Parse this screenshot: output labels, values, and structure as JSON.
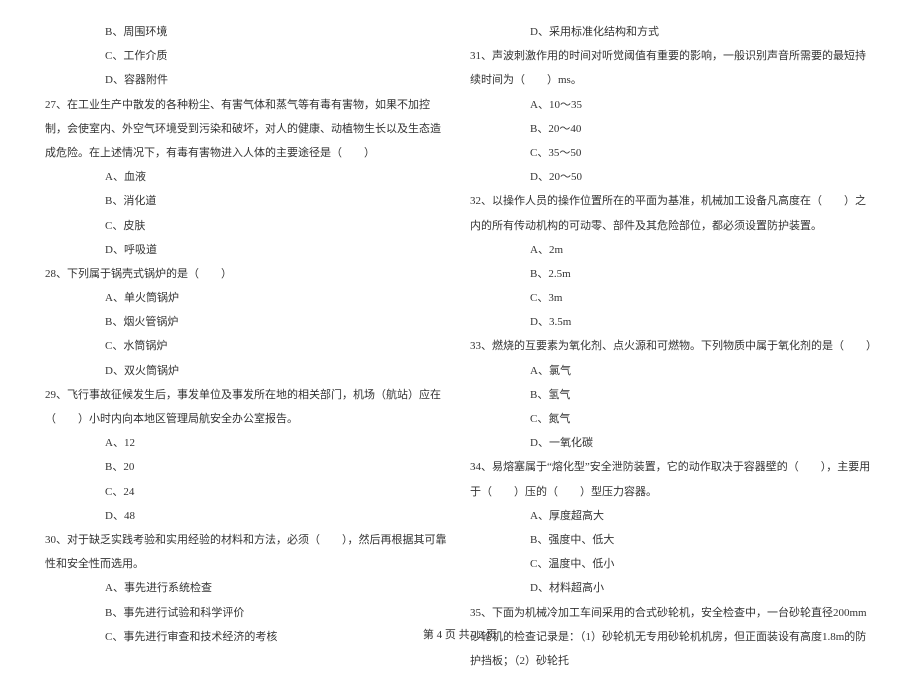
{
  "left": {
    "opt_b_26": "B、周围环境",
    "opt_c_26": "C、工作介质",
    "opt_d_26": "D、容器附件",
    "q27": "27、在工业生产中散发的各种粉尘、有害气体和蒸气等有毒有害物，如果不加控制，会使室内、外空气环境受到污染和破坏，对人的健康、动植物生长以及生态造成危险。在上述情况下，有毒有害物进入人体的主要途径是（　　）",
    "q27_a": "A、血液",
    "q27_b": "B、消化道",
    "q27_c": "C、皮肤",
    "q27_d": "D、呼吸道",
    "q28": "28、下列属于锅壳式锅炉的是（　　）",
    "q28_a": "A、单火筒锅炉",
    "q28_b": "B、烟火管锅炉",
    "q28_c": "C、水筒锅炉",
    "q28_d": "D、双火筒锅炉",
    "q29": "29、飞行事故征候发生后，事发单位及事发所在地的相关部门，机场（航站）应在（　　）小时内向本地区管理局航安全办公室报告。",
    "q29_a": "A、12",
    "q29_b": "B、20",
    "q29_c": "C、24",
    "q29_d": "D、48",
    "q30": "30、对于缺乏实践考验和实用经验的材料和方法，必须（　　），然后再根据其可靠性和安全性而选用。",
    "q30_a": "A、事先进行系统检查",
    "q30_b": "B、事先进行试验和科学评价",
    "q30_c": "C、事先进行审查和技术经济的考核"
  },
  "right": {
    "q30_d": "D、采用标准化结构和方式",
    "q31": "31、声波刺激作用的时间对听觉阈值有重要的影响，一般识别声音所需要的最短持续时间为（　　）ms。",
    "q31_a": "A、10～35",
    "q31_b": "B、20～40",
    "q31_c": "C、35～50",
    "q31_d": "D、20～50",
    "q32": "32、以操作人员的操作位置所在的平面为基准，机械加工设备凡高度在（　　）之内的所有传动机构的可动零、部件及其危险部位，都必须设置防护装置。",
    "q32_a": "A、2m",
    "q32_b": "B、2.5m",
    "q32_c": "C、3m",
    "q32_d": "D、3.5m",
    "q33": "33、燃烧的互要素为氧化剂、点火源和可燃物。下列物质中属于氧化剂的是（　　）",
    "q33_a": "A、氯气",
    "q33_b": "B、氢气",
    "q33_c": "C、氮气",
    "q33_d": "D、一氧化碳",
    "q34": "34、易熔塞属于“熔化型”安全泄防装置，它的动作取决于容器壁的（　　），主要用于（　　）压的（　　）型压力容器。",
    "q34_a": "A、厚度超高大",
    "q34_b": "B、强度中、低大",
    "q34_c": "C、温度中、低小",
    "q34_d": "D、材料超高小",
    "q35": "35、下面为机械冷加工车间采用的合式砂轮机，安全检查中，一台砂轮直径200mm砂轮机的检查记录是：（1）砂轮机无专用砂轮机机房，但正面装设有高度1.8m的防护挡板；（2）砂轮托"
  },
  "footer": "第 4 页 共 12 页"
}
